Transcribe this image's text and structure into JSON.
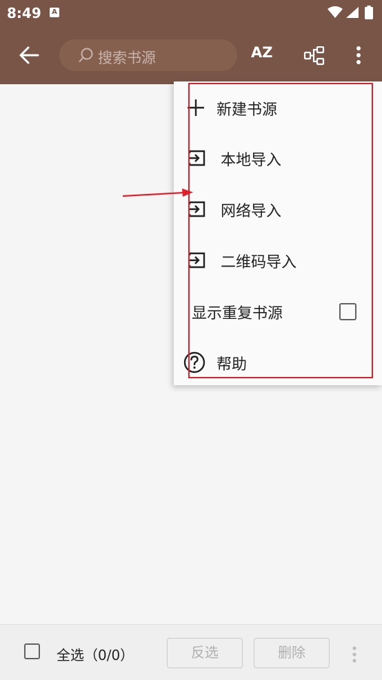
{
  "status_bar": {
    "time": "8:49",
    "notification_glyph": "A"
  },
  "toolbar": {
    "search_placeholder": "搜索书源",
    "sort_label": "AZ"
  },
  "menu": {
    "items": [
      {
        "label": "新建书源",
        "icon": "plus-icon"
      },
      {
        "label": "本地导入",
        "icon": "import-icon"
      },
      {
        "label": "网络导入",
        "icon": "import-icon"
      },
      {
        "label": "二维码导入",
        "icon": "import-icon"
      },
      {
        "label": "显示重复书源",
        "icon": "checkbox",
        "checked": false
      },
      {
        "label": "帮助",
        "icon": "help-icon"
      }
    ]
  },
  "bottom_bar": {
    "select_all_label": "全选（0/0）",
    "invert_label": "反选",
    "delete_label": "删除",
    "select_all_checked": false
  },
  "colors": {
    "toolbar_bg": "#795548",
    "annotation_red": "#e0202a"
  }
}
